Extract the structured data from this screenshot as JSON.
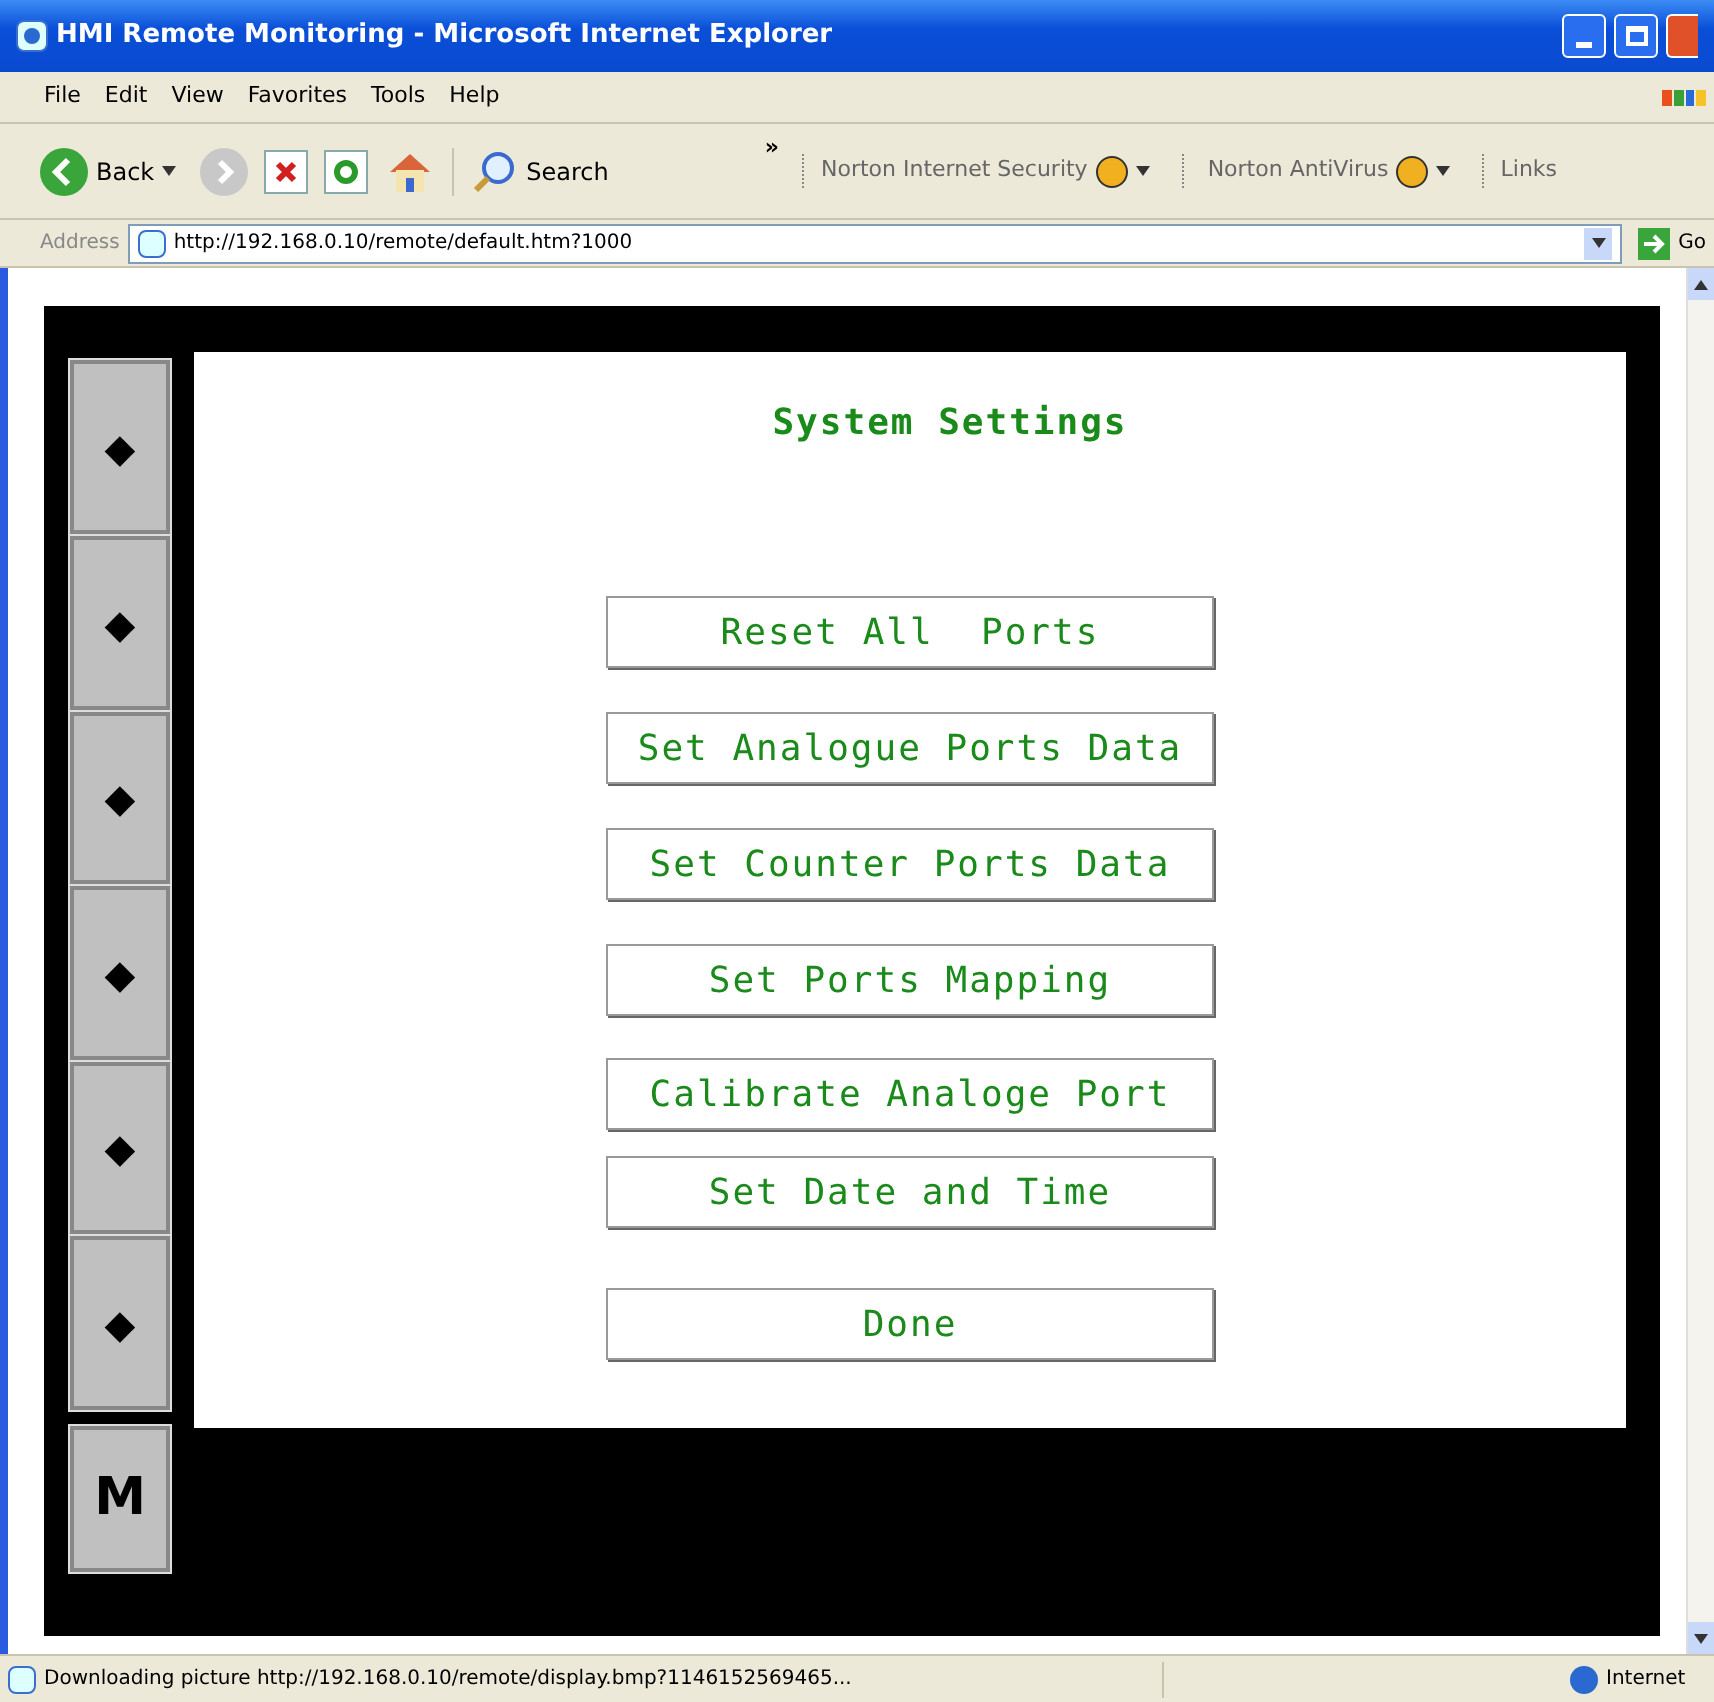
{
  "window": {
    "title": "HMI Remote Monitoring - Microsoft Internet Explorer"
  },
  "menu": [
    "File",
    "Edit",
    "View",
    "Favorites",
    "Tools",
    "Help"
  ],
  "toolbar": {
    "back": "Back",
    "search": "Search",
    "chevron": "»",
    "norton_security": "Norton Internet Security",
    "norton_antivirus": "Norton AntiVirus",
    "links": "Links"
  },
  "address_bar": {
    "label": "Address",
    "url": "http://192.168.0.10/remote/default.htm?1000",
    "go": "Go"
  },
  "hmi": {
    "side_buttons": [
      "◆",
      "◆",
      "◆",
      "◆",
      "◆",
      "◆",
      "M"
    ],
    "title": "System Settings",
    "buttons": [
      "Reset All  Ports",
      "Set Analogue Ports Data",
      "Set Counter Ports Data",
      "Set Ports Mapping",
      "Calibrate Analoge Port",
      "Set Date and Time",
      "Done"
    ]
  },
  "status_bar": {
    "message": "Downloading picture http://192.168.0.10/remote/display.bmp?1146152569465...",
    "zone": "Internet"
  }
}
